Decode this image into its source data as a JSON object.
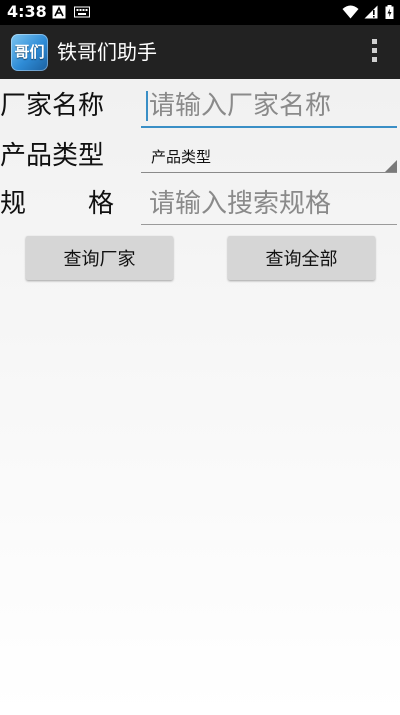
{
  "status_bar": {
    "time": "4:38",
    "icons": [
      "notification-a-icon",
      "keyboard-icon",
      "wifi-icon",
      "signal-icon",
      "battery-icon"
    ]
  },
  "app_bar": {
    "app_icon_glyph": "哥们",
    "title": "铁哥们助手",
    "overflow_icon": "more-vert-icon"
  },
  "form": {
    "manufacturer": {
      "label": "厂家名称",
      "placeholder": "请输入厂家名称",
      "value": ""
    },
    "product_type": {
      "label": "产品类型",
      "selected": "产品类型"
    },
    "spec": {
      "label_char_1": "规",
      "label_char_2": "格",
      "placeholder": "请输入搜索规格",
      "value": ""
    }
  },
  "buttons": {
    "query_manufacturer": "查询厂家",
    "query_all": "查询全部"
  },
  "colors": {
    "status_bar": "#000000",
    "action_bar": "#222222",
    "focus_underline": "#3a8fc6",
    "inactive_underline": "#9a9a9a",
    "button_bg": "#d6d6d6"
  }
}
